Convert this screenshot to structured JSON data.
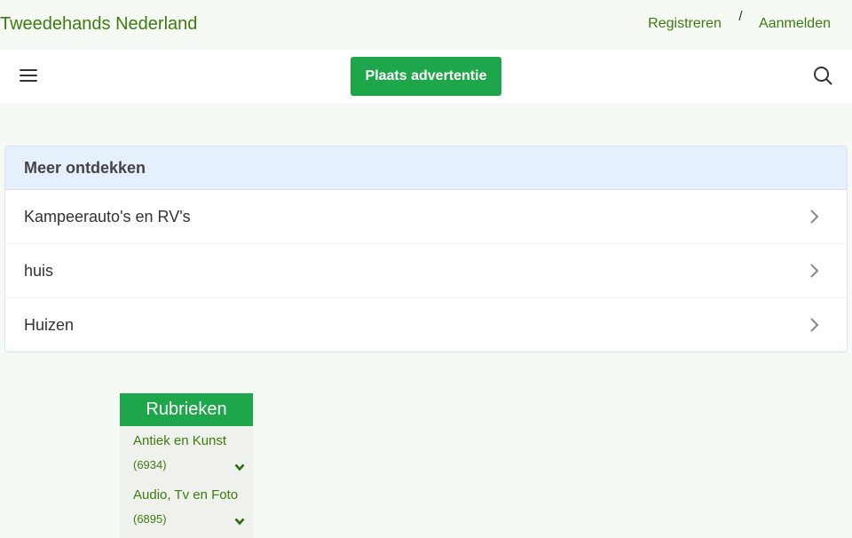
{
  "header": {
    "site_title": "Tweedehands Nederland",
    "register_label": "Registreren",
    "separator": "/",
    "login_label": "Aanmelden"
  },
  "navbar": {
    "menu_icon": "hamburger-menu-icon",
    "post_ad_label": "Plaats advertentie",
    "search_icon": "search-icon"
  },
  "discover": {
    "title": "Meer ontdekken",
    "items": [
      {
        "label": "Kampeerauto's en RV's"
      },
      {
        "label": "huis"
      },
      {
        "label": "Huizen"
      }
    ]
  },
  "categories": {
    "title": "Rubrieken",
    "items": [
      {
        "name": "Antiek en Kunst",
        "count": "(6934)"
      },
      {
        "name": "Audio, Tv en Foto",
        "count": "(6895)"
      }
    ]
  },
  "colors": {
    "brand_green": "#1da64a",
    "link_green": "#3f7a10",
    "discover_header_bg": "#e6f0fc"
  }
}
